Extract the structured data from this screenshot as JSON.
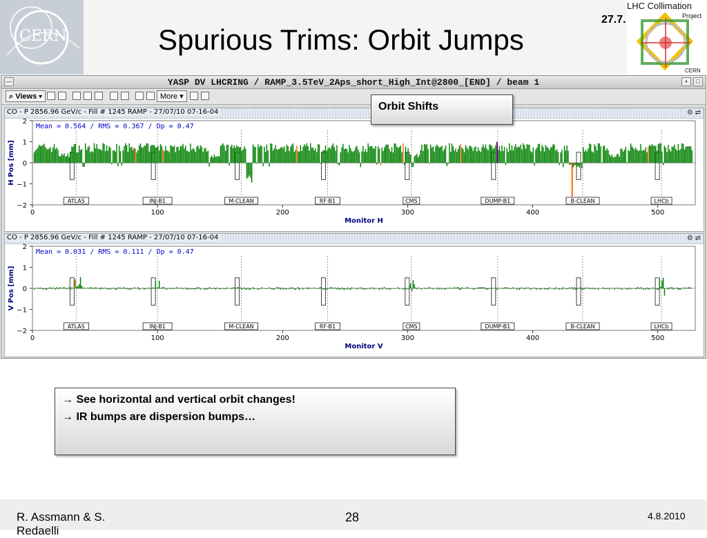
{
  "slide": {
    "title": "Spurious Trims: Orbit Jumps",
    "date_top": "27.7.",
    "cern_logo_text": "CERN",
    "lhc_logo": {
      "line1": "LHC Collimation",
      "line2": "Project",
      "line3": "CERN"
    }
  },
  "window": {
    "title": "YASP DV LHCRING / RAMP_3.5TeV_2Aps_short_High_Int@2800_[END] / beam 1",
    "toolbar": {
      "views_label": "Views",
      "more_label": "More"
    }
  },
  "callout": {
    "label": "Orbit Shifts"
  },
  "panels": [
    {
      "header": "CO - P 2856.96 GeV/c - Fill # 1245 RAMP - 27/07/10 07-16-04",
      "stats": "Mean =   0.564 / RMS =   0.367 / Dp =   0.47",
      "ylabel": "H Pos [mm]",
      "xlabel": "Monitor H",
      "amp": 0.55,
      "yticks": [
        "2",
        "1",
        "0",
        "−1",
        "−2"
      ],
      "xticks": [
        "0",
        "100",
        "200",
        "300",
        "400",
        "500"
      ]
    },
    {
      "header": "CO - P 2856.96 GeV/c - Fill # 1245 RAMP - 27/07/10 07-16-04",
      "stats": "Mean =   0.031 / RMS =   0.111 / Dp =   0.47",
      "ylabel": "V Pos [mm]",
      "xlabel": "Monitor V",
      "amp": 0.08,
      "yticks": [
        "2",
        "1",
        "0",
        "−1",
        "−2"
      ],
      "xticks": [
        "0",
        "100",
        "200",
        "300",
        "400",
        "500"
      ]
    }
  ],
  "chart_data": {
    "type": "bar",
    "x_range": [
      0,
      530
    ],
    "ylim": [
      -2,
      2
    ],
    "ir_markers": [
      {
        "label": "ATLAS",
        "x": 35
      },
      {
        "label": "INJ-B1",
        "x": 100
      },
      {
        "label": "M-CLEAN",
        "x": 167
      },
      {
        "label": "RF-B1",
        "x": 236
      },
      {
        "label": "CMS",
        "x": 303
      },
      {
        "label": "DUMP-B1",
        "x": 372
      },
      {
        "label": "B-CLEAN",
        "x": 440
      },
      {
        "label": "LHCb",
        "x": 503
      }
    ]
  },
  "notes": [
    "→ See horizontal and vertical orbit changes!",
    "→ IR bumps are dispersion bumps…"
  ],
  "footer": {
    "author": "R. Assmann & S. Redaelli",
    "page": "28",
    "date": "4.8.2010"
  },
  "colors": {
    "bars": "#008000",
    "highlight": "#ff6600",
    "purple": "#7a0a8a",
    "axis_label": "#000080",
    "stats": "#0000cc"
  }
}
